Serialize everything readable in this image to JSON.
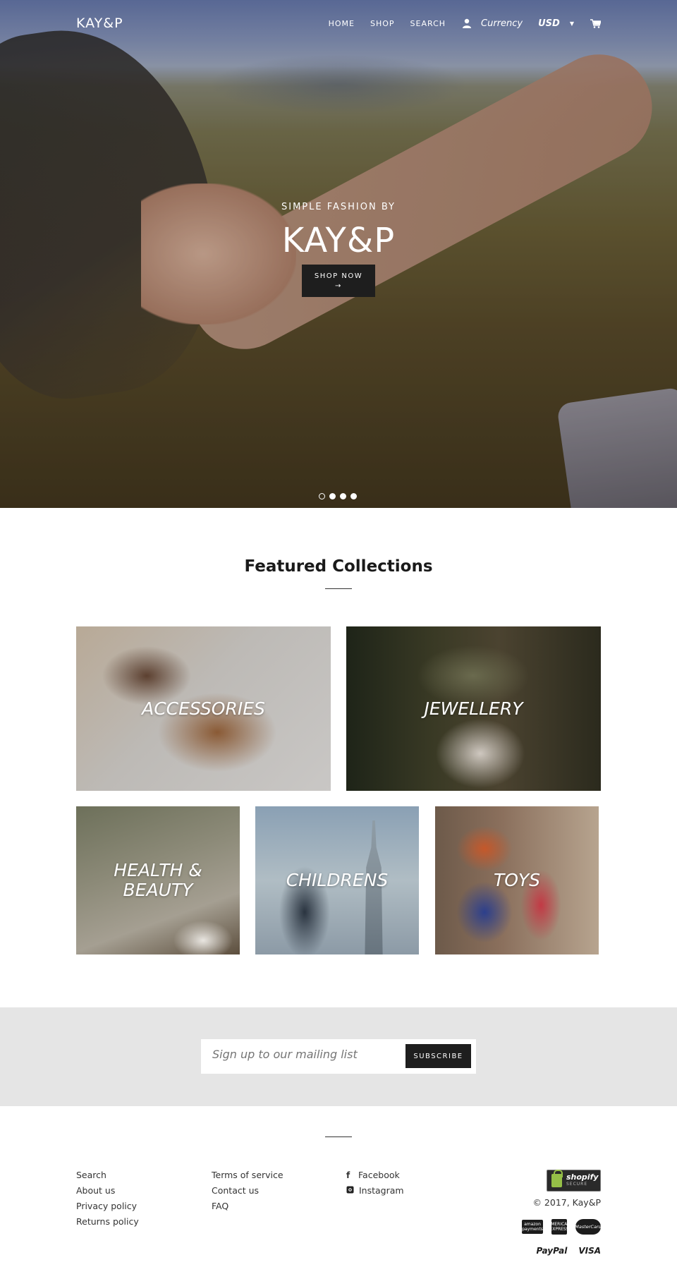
{
  "header": {
    "logo": "KAY&P",
    "nav": [
      "HOME",
      "SHOP",
      "SEARCH"
    ],
    "currency_label": "Currency",
    "currency_value": "USD"
  },
  "hero": {
    "subtitle": "SIMPLE FASHION BY",
    "title": "KAY&P",
    "button_label": "SHOP NOW",
    "button_arrow": "→",
    "slides": 4,
    "active_slide": 1
  },
  "featured": {
    "title": "Featured Collections",
    "collections": [
      "ACCESSORIES",
      "JEWELLERY",
      "HEALTH & BEAUTY",
      "CHILDRENS",
      "TOYS"
    ]
  },
  "newsletter": {
    "placeholder": "Sign up to our mailing list",
    "button_label": "SUBSCRIBE"
  },
  "footer": {
    "col1": [
      "Search",
      "About us",
      "Privacy policy",
      "Returns policy"
    ],
    "col2": [
      "Terms of service",
      "Contact us",
      "FAQ"
    ],
    "social": [
      "Facebook",
      "Instagram"
    ],
    "shopify_badge": {
      "line1": "shopify",
      "line2": "SECURE"
    },
    "copyright": "© 2017, Kay&P",
    "payments": {
      "amazon": "amazon payments",
      "amex": "AMERICAN EXPRESS",
      "mastercard": "MasterCard",
      "paypal": "PayPal",
      "visa": "VISA"
    }
  }
}
